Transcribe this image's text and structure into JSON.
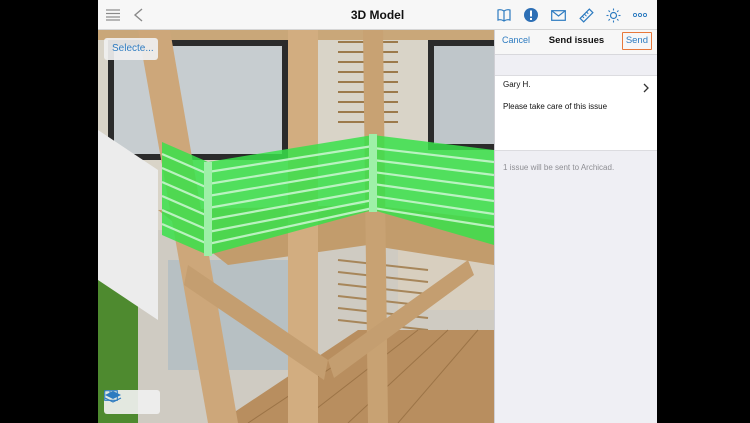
{
  "toolbar": {
    "title": "3D Model",
    "icons": [
      "menu-icon",
      "back-icon",
      "book-icon",
      "issues-badge-icon",
      "mail-icon",
      "ruler-icon",
      "sun-icon",
      "more-icon"
    ]
  },
  "viewport": {
    "selection_chip": "Selecte...",
    "highlight_color": "#38e04a"
  },
  "panel": {
    "cancel_label": "Cancel",
    "title": "Send issues",
    "send_label": "Send",
    "assignee": "Gary H.",
    "comment": "Please take care of this issue",
    "info": "1 issue will be sent to Archicad."
  },
  "colors": {
    "accent": "#2d7bc0",
    "send_border": "#e8783a"
  }
}
